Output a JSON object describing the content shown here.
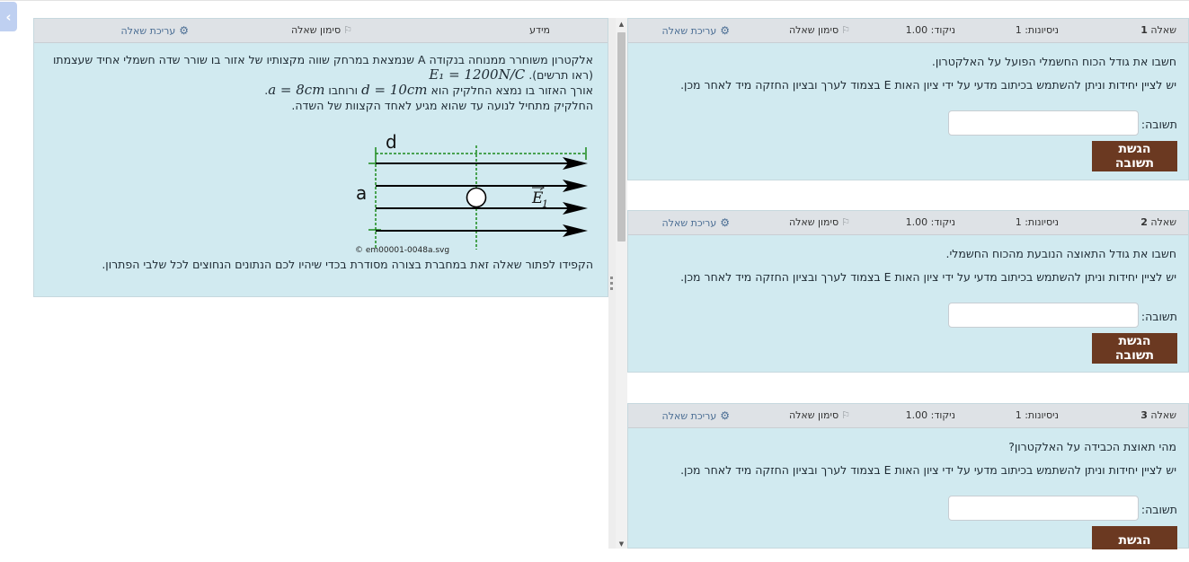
{
  "info": {
    "header": {
      "label": "מידע",
      "flag": "סימון שאלה",
      "edit": "עריכת שאלה"
    },
    "line1": "אלקטרון משוחרר ממנוחה בנקודה A שנמצאת במרחק שווה מקצותיו של אזור בו שורר שדה חשמלי אחיד שעצמתו",
    "line2_prefix": "(ראו תרשים).",
    "field_math": "E₁ = 1200N/C",
    "line3_prefix": "אורך האזור בו נמצא החלקיק הוא",
    "d_math": "d = 10cm",
    "line3_mid": "ורוחבו",
    "a_math": "a = 8cm",
    "line4": "החלקיק מתחיל לנועה עד שהוא מגיע לאחד הקצוות של השדה.",
    "diagram": {
      "label_d": "d",
      "label_a": "a",
      "label_e": "E",
      "label_e_sub": "1"
    },
    "caption": "em00001-0048a.svg",
    "note": "הקפידו לפתור שאלה זאת במחברת בצורה מסודרת בכדי שיהיו לכם הנתונים הנחוצים לכל שלבי הפתרון."
  },
  "questions": [
    {
      "label": "שאלה",
      "number": "1",
      "attempts": "ניסיונות: 1",
      "score": "ניקוד: 1.00",
      "flag": "סימון שאלה",
      "edit": "עריכת שאלה",
      "text": "חשבו את גודל הכוח החשמלי הפועל על האלקטרון.",
      "instructions": "יש לציין יחידות וניתן להשתמש בכיתוב מדעי על ידי ציון האות E בצמוד לערך ובציון החזקה מיד לאחר מכן.",
      "answer_label": "תשובה:",
      "answer_value": "",
      "submit": "הגשת תשובה"
    },
    {
      "label": "שאלה",
      "number": "2",
      "attempts": "ניסיונות: 1",
      "score": "ניקוד: 1.00",
      "flag": "סימון שאלה",
      "edit": "עריכת שאלה",
      "text": "חשבו את גודל התאוצה הנובעת מהכוח החשמלי.",
      "instructions": "יש לציין יחידות וניתן להשתמש בכיתוב מדעי על ידי ציון האות E בצמוד לערך ובציון החזקה מיד לאחר מכן.",
      "answer_label": "תשובה:",
      "answer_value": "",
      "submit": "הגשת תשובה"
    },
    {
      "label": "שאלה",
      "number": "3",
      "attempts": "ניסיונות: 1",
      "score": "ניקוד: 1.00",
      "flag": "סימון שאלה",
      "edit": "עריכת שאלה",
      "text": "מהי תאוצת הכבידה על האלקטרון?",
      "instructions": "יש לציין יחידות וניתן להשתמש בכיתוב מדעי על ידי ציון האות E בצמוד לערך ובציון החזקה מיד לאחר מכן.",
      "answer_label": "תשובה:",
      "answer_value": "",
      "submit": "הגשת תשובה"
    }
  ],
  "colors": {
    "panel": "#d1eaf0",
    "header": "#dee2e6",
    "submit": "#6b3921",
    "link": "#4b6e94",
    "guide": "#1a8a1a"
  }
}
